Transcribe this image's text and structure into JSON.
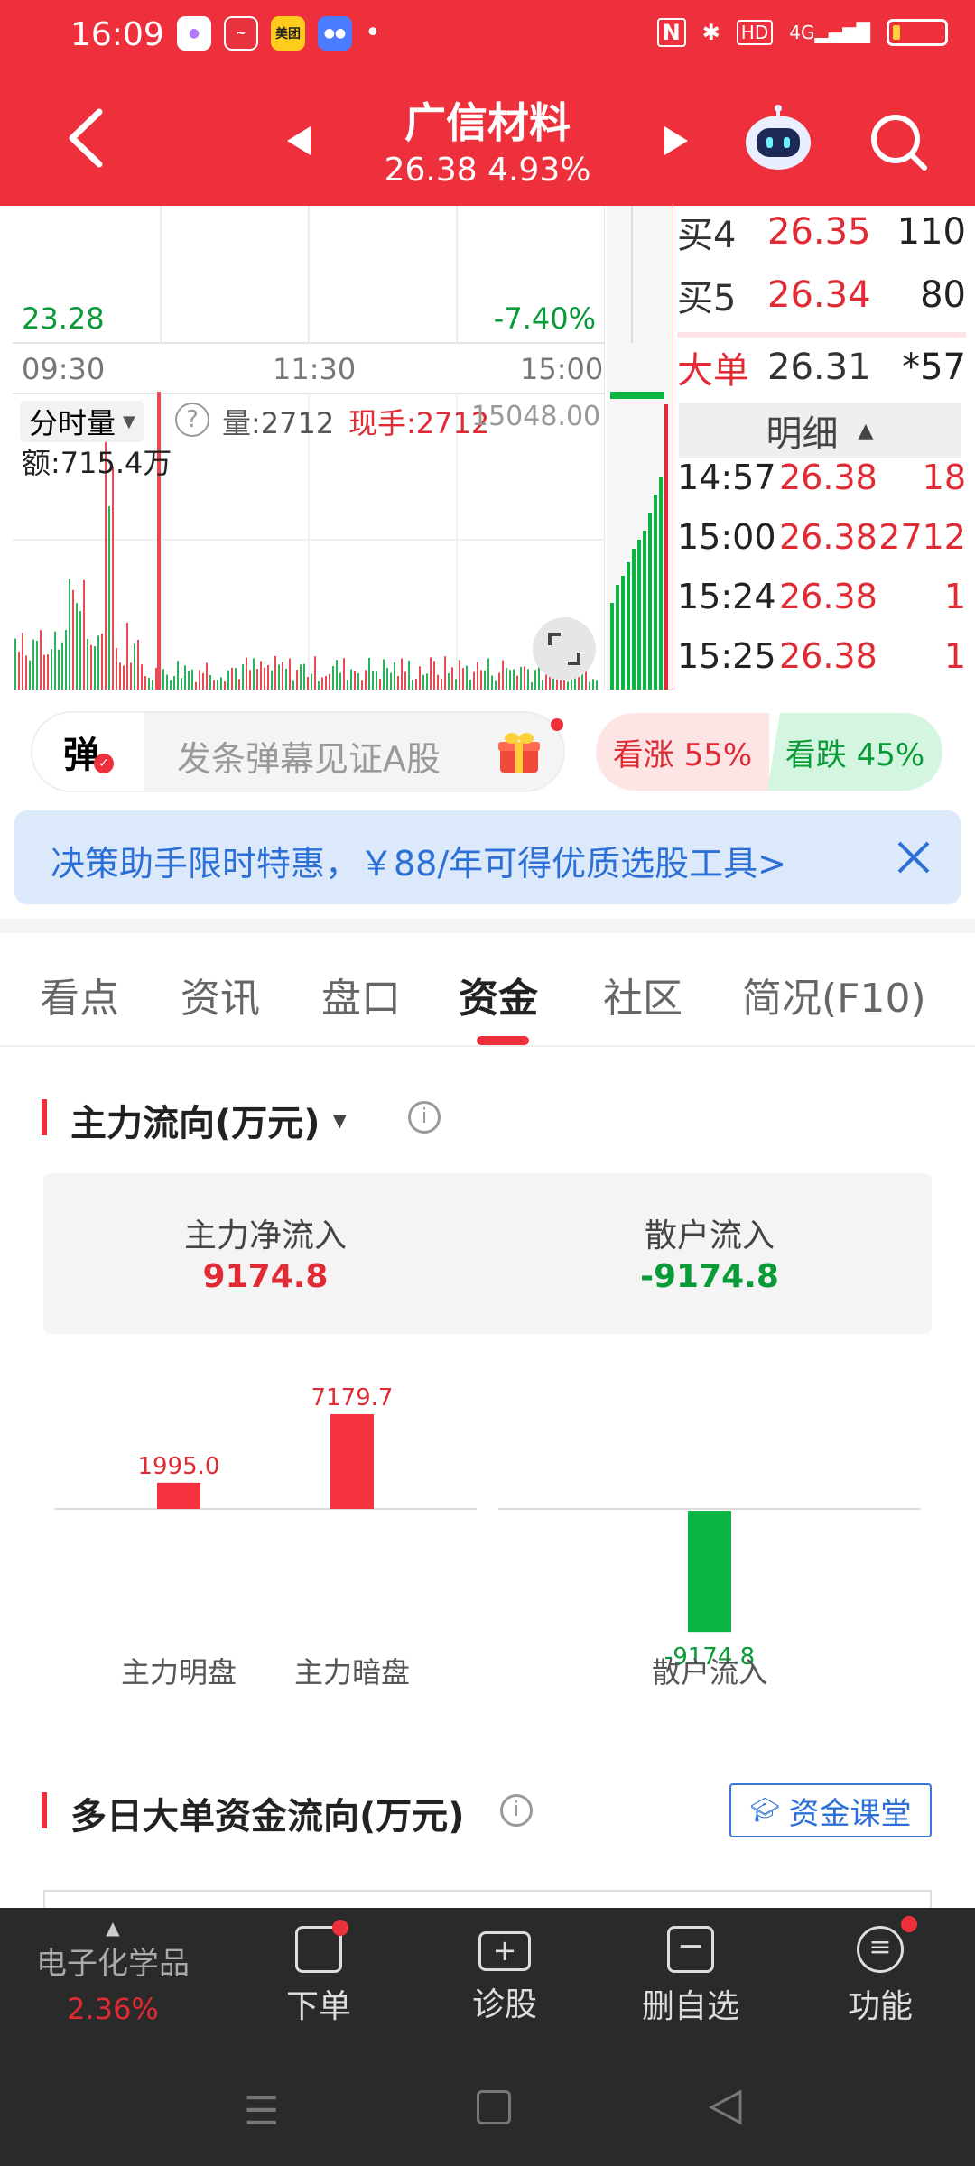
{
  "status": {
    "time": "16:09",
    "network": "4G",
    "hd": "HD"
  },
  "header": {
    "title": "广信材料",
    "price_change": "26.38 4.93%"
  },
  "chart": {
    "low_price": "23.28",
    "low_pct": "-7.40%",
    "time_labels": [
      "09:30",
      "11:30",
      "15:00"
    ],
    "vol_selector": "分时量",
    "vol_text": "量:2712",
    "now_hand": "现手:2712",
    "vol_max": "15048.00",
    "amount": "额:715.4万"
  },
  "orderbook": [
    {
      "label": "买4",
      "price": "26.35",
      "vol": "110"
    },
    {
      "label": "买5",
      "price": "26.34",
      "vol": "80"
    }
  ],
  "big_order": {
    "label": "大单",
    "price": "26.31",
    "vol": "*57"
  },
  "detail": {
    "label": "明细"
  },
  "ticks": [
    {
      "time": "14:57",
      "price": "26.38",
      "vol": "18"
    },
    {
      "time": "15:00",
      "price": "26.38",
      "vol": "2712"
    },
    {
      "time": "15:24",
      "price": "26.38",
      "vol": "1"
    },
    {
      "time": "15:25",
      "price": "26.38",
      "vol": "1"
    }
  ],
  "danmu": {
    "icon_label": "弹",
    "placeholder": "发条弹幕见证A股",
    "bull": "看涨 55%",
    "bear": "看跌 45%"
  },
  "banner": {
    "text": "决策助手限时特惠，￥88/年可得优质选股工具>"
  },
  "tabs": [
    "看点",
    "资讯",
    "盘口",
    "资金",
    "社区",
    "简况(F10)"
  ],
  "capital": {
    "section_title": "主力流向(万元)",
    "main_inflow_label": "主力净流入",
    "main_inflow_value": "9174.8",
    "retail_inflow_label": "散户流入",
    "retail_inflow_value": "-9174.8"
  },
  "chart_data": {
    "type": "bar",
    "categories": [
      "主力明盘",
      "主力暗盘",
      "散户流入"
    ],
    "values": [
      1995.0,
      7179.7,
      -9174.8
    ],
    "value_labels": [
      "1995.0",
      "7179.7",
      "-9174.8"
    ],
    "colors": [
      "#f5333f",
      "#f5333f",
      "#0ab543"
    ]
  },
  "multiday": {
    "title": "多日大单资金流向(万元)",
    "class_button": "资金课堂"
  },
  "bottom_nav": {
    "sector": "电子化学品",
    "sector_pct": "2.36%",
    "items": [
      "下单",
      "诊股",
      "删自选",
      "功能"
    ]
  },
  "colors": {
    "brand": "#ee303c",
    "up": "#e02b35",
    "down": "#0a9a37"
  }
}
